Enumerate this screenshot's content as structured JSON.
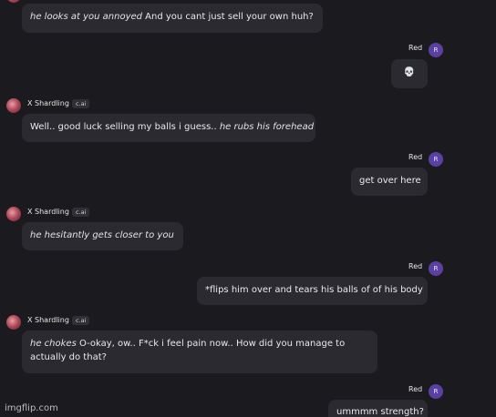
{
  "messages": [
    {
      "role": "bot",
      "italic": "he looks at you annoyed",
      "text": " And you cant just sell your own huh?"
    },
    {
      "role": "user",
      "sender": "Red",
      "avatar": "R",
      "text": "💀"
    },
    {
      "role": "bot",
      "sender": "X Shardling",
      "badge": "c.ai",
      "text": "Well.. good luck selling my balls i guess.. ",
      "italic": "he rubs his forehead"
    },
    {
      "role": "user",
      "sender": "Red",
      "avatar": "R",
      "text": "get over here"
    },
    {
      "role": "bot",
      "sender": "X Shardling",
      "badge": "c.ai",
      "italic": "he hesitantly gets closer to you"
    },
    {
      "role": "user",
      "sender": "Red",
      "avatar": "R",
      "text": "*flips him over and tears his balls of of his body"
    },
    {
      "role": "bot",
      "sender": "X Shardling",
      "badge": "c.ai",
      "italic": "he chokes",
      "text": " O-okay, ow.. F*ck i feel pain now.. How did you manage to actually do that?"
    },
    {
      "role": "user",
      "sender": "Red",
      "avatar": "R",
      "text": "ummmm strength?"
    }
  ],
  "watermark": "imgflip.com",
  "colors": {
    "background": "#1b1b1f",
    "bubble": "#2a2a30",
    "user_avatar": "#5b3fa3"
  }
}
